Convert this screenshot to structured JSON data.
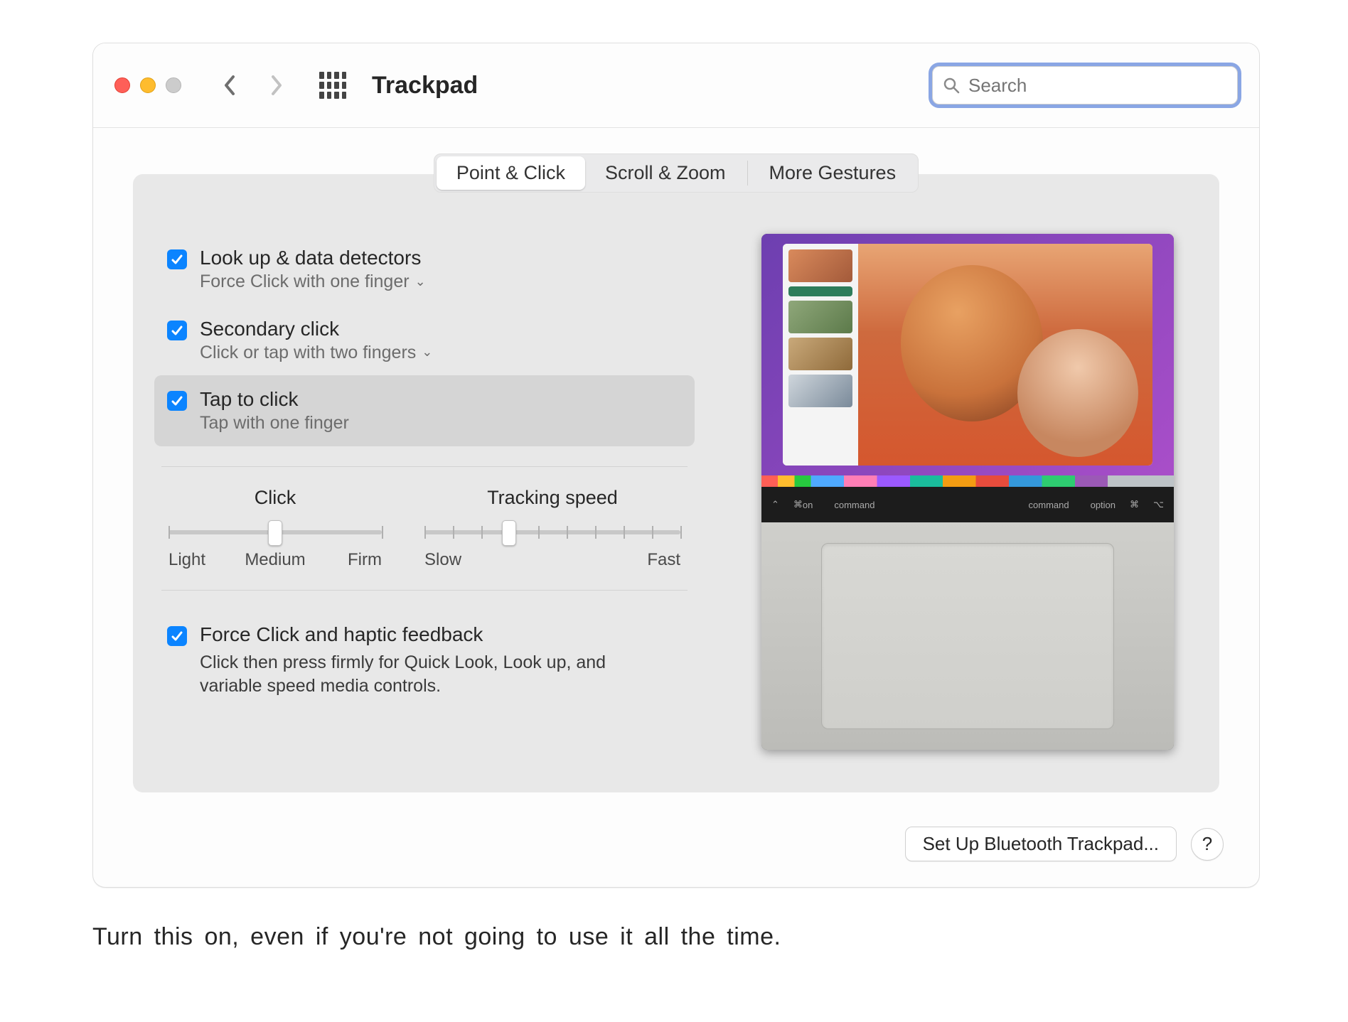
{
  "toolbar": {
    "title": "Trackpad",
    "search_placeholder": "Search"
  },
  "tabs": {
    "point_click": "Point & Click",
    "scroll_zoom": "Scroll & Zoom",
    "more_gestures": "More Gestures",
    "active": "point_click"
  },
  "options": {
    "lookup": {
      "title": "Look up & data detectors",
      "subtitle": "Force Click with one finger",
      "checked": true,
      "has_dropdown": true
    },
    "secondary": {
      "title": "Secondary click",
      "subtitle": "Click or tap with two fingers",
      "checked": true,
      "has_dropdown": true
    },
    "tap": {
      "title": "Tap to click",
      "subtitle": "Tap with one finger",
      "checked": true,
      "has_dropdown": false,
      "highlighted": true
    },
    "force": {
      "title": "Force Click and haptic feedback",
      "description": "Click then press firmly for Quick Look, Look up, and variable speed media controls.",
      "checked": true
    }
  },
  "sliders": {
    "click": {
      "title": "Click",
      "labels": [
        "Light",
        "Medium",
        "Firm"
      ],
      "ticks": 3,
      "value_index": 1
    },
    "tracking": {
      "title": "Tracking speed",
      "labels": [
        "Slow",
        "Fast"
      ],
      "ticks": 10,
      "value_index": 3
    }
  },
  "preview": {
    "keyboard_keys_left": [
      "on",
      "command"
    ],
    "keyboard_keys_right": [
      "command",
      "option"
    ],
    "keyboard_symbols": [
      "⌃",
      "⌘",
      "⌘",
      "⌥"
    ]
  },
  "bottom": {
    "bluetooth_button": "Set Up Bluetooth Trackpad...",
    "help": "?"
  },
  "caption": "Turn this on, even if you're not going to use it all the time."
}
